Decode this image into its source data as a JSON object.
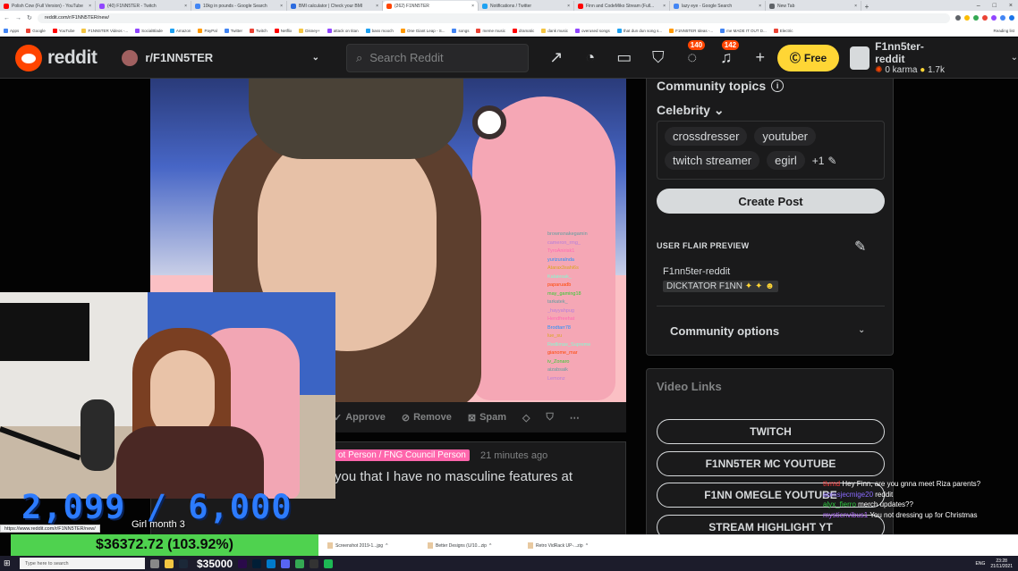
{
  "browser": {
    "tabs": [
      {
        "title": "Polish Cow (Full Version) - YouTube",
        "color": "#ff0000"
      },
      {
        "title": "(40) F1NN5TER - Twitch",
        "color": "#9146ff"
      },
      {
        "title": "10kg in pounds - Google Search",
        "color": "#4285f4"
      },
      {
        "title": "BMI calculator | Check your BMI",
        "color": "#2d6cdf"
      },
      {
        "title": "(262) F1NN5TER",
        "color": "#ff4500",
        "active": true
      },
      {
        "title": "Notifications / Twitter",
        "color": "#1da1f2"
      },
      {
        "title": "Finn and CodeMiko Stream (Full...",
        "color": "#ff0000"
      },
      {
        "title": "lazy eye - Google Search",
        "color": "#4285f4"
      },
      {
        "title": "New Tab",
        "color": "#5f6368"
      }
    ],
    "new_tab": "+",
    "url": "reddit.com/r/F1NN5TER/new/",
    "bookmarks": [
      "Apps",
      "Google",
      "YouTube",
      "F1NN5TER Videos -...",
      "SocialBlade",
      "Amazon",
      "PayPal",
      "Twitter",
      "Twitch",
      "Netflix",
      "Disney+",
      "attack on titan",
      "bass mooch",
      "One Giant Leap - S...",
      "songs",
      "meme music",
      "dramatic",
      "dank music",
      "overused songs",
      "that dun dun song s...",
      "F1NN5TER Ideas -...",
      "me MADE IT OUT D...",
      "Electric"
    ],
    "reading_list": "Reading list"
  },
  "reddit_header": {
    "logo": "reddit",
    "community": "r/F1NN5TER",
    "search_placeholder": "Search Reddit",
    "chat_count": "140",
    "notif_count": "142",
    "free_label": "Free",
    "username": "F1nn5ter-reddit",
    "karma": "0 karma",
    "coins": "1.7k"
  },
  "post_actions": {
    "approve": "Approve",
    "remove": "Remove",
    "spam": "Spam"
  },
  "post": {
    "flair": "ot Person / FNG Council Person",
    "time": "21 minutes ago",
    "title": "you that I have no masculine features at"
  },
  "sidebar": {
    "community_topics": "Community topics",
    "category": "Celebrity",
    "topics": [
      "crossdresser",
      "youtuber",
      "twitch streamer",
      "egirl"
    ],
    "more_topics": "+1",
    "create_post": "Create Post",
    "user_flair_preview": "USER FLAIR PREVIEW",
    "flair_username": "F1nn5ter-reddit",
    "flair_text": "DICKTATOR F1NN",
    "community_options": "Community options",
    "video_links_title": "Video Links",
    "video_links": [
      "TWITCH",
      "F1NN5TER MC YOUTUBE",
      "F1NN OMEGLE YOUTUBE",
      "STREAM HIGHLIGHT YT"
    ]
  },
  "stream_overlay": {
    "goal_text": "2,099 / 6,000",
    "goal_label": "Girl month 3",
    "money": "$36372.72 (103.92%)",
    "taskbar_money": "$35000",
    "status_url": "https://www.reddit.com/r/F1NN5TER/new/"
  },
  "inner_chat": [
    "brownsnakegamin",
    "cameron_rmg_",
    "TyroAnirisk1",
    "yurizuralnda",
    "Atarax3sahi6s",
    "Kalaiesak_",
    "paparuadb",
    "may_gaming18",
    "tarkatek_",
    "_hayyahpug",
    "Hendfreehat",
    "Brodtarr78",
    "lue_su",
    "Redlimax_Supreme",
    "gianome_mar",
    "iv_Zonaro",
    "aizabsaik",
    "Lemonz"
  ],
  "downloads": [
    "Screenshot 2019-1...jpg",
    "Better Designs (U/10...zip",
    "Retro VidRack UP-...zip"
  ],
  "twitch_chat": [
    {
      "user": "tlvmd",
      "msg": "Hey Finn, are you gnna meet Riza parents?"
    },
    {
      "user": "aomsjecmige20",
      "msg": "reddit"
    },
    {
      "user": "alyx_fierro",
      "msg": "merch updates??"
    },
    {
      "user": "mysticnvibus1",
      "msg": "You not dressing up for Christmas"
    }
  ],
  "taskbar": {
    "search_placeholder": "Type here to search",
    "time": "23:28",
    "date": "21/11/2021",
    "lang": "ENG"
  }
}
